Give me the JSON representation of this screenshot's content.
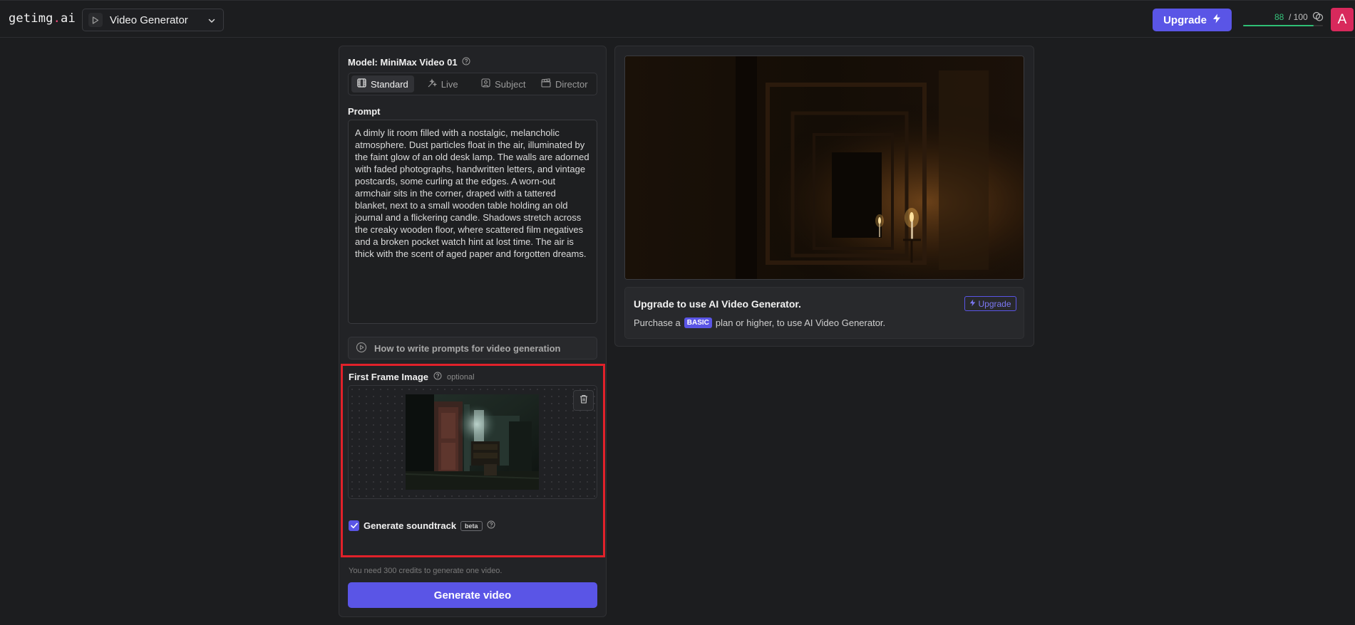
{
  "header": {
    "logo_main": "getimg",
    "logo_dot": ".",
    "logo_tld": "ai",
    "tool_selector": {
      "label": "Video Generator",
      "icon": "play-icon"
    },
    "upgrade_button": {
      "label": "Upgrade",
      "icon": "lightning-icon"
    },
    "credits": {
      "current": "88",
      "total": "/ 100",
      "fraction": 0.88,
      "icon": "coins-icon"
    },
    "avatar_letter": "A"
  },
  "left_panel": {
    "model_title": "Model: MiniMax Video 01",
    "mode_tabs": [
      {
        "label": "Standard",
        "icon": "film-icon",
        "active": true
      },
      {
        "label": "Live",
        "icon": "sparkle-icon",
        "active": false
      },
      {
        "label": "Subject",
        "icon": "user-square-icon",
        "active": false
      },
      {
        "label": "Director",
        "icon": "clapperboard-icon",
        "active": false
      }
    ],
    "prompt_label": "Prompt",
    "prompt_text": "A dimly lit room filled with a nostalgic, melancholic atmosphere. Dust particles float in the air, illuminated by the faint glow of an old desk lamp. The walls are adorned with faded photographs, handwritten letters, and vintage postcards, some curling at the edges. A worn-out armchair sits in the corner, draped with a tattered blanket, next to a small wooden table holding an old journal and a flickering candle. Shadows stretch across the creaky wooden floor, where scattered film negatives and a broken pocket watch hint at lost time. The air is thick with the scent of aged paper and forgotten dreams.",
    "how_to_label": "How to write prompts for video generation",
    "first_frame": {
      "label": "First Frame Image",
      "optional": "optional"
    },
    "soundtrack": {
      "label": "Generate soundtrack",
      "badge": "beta",
      "checked": true
    },
    "credits_note": "You need 300 credits to generate one video.",
    "generate_button": "Generate video"
  },
  "right_panel": {
    "upsell_title": "Upgrade to use AI Video Generator.",
    "upsell_prefix": "Purchase a",
    "upsell_badge": "BASIC",
    "upsell_suffix": "plan or higher, to use AI Video Generator.",
    "upsell_button": "Upgrade"
  },
  "colors": {
    "accent": "#5a55e6",
    "highlight_border": "#e0212a",
    "credits_green": "#35c27a",
    "avatar": "#d8295c"
  }
}
